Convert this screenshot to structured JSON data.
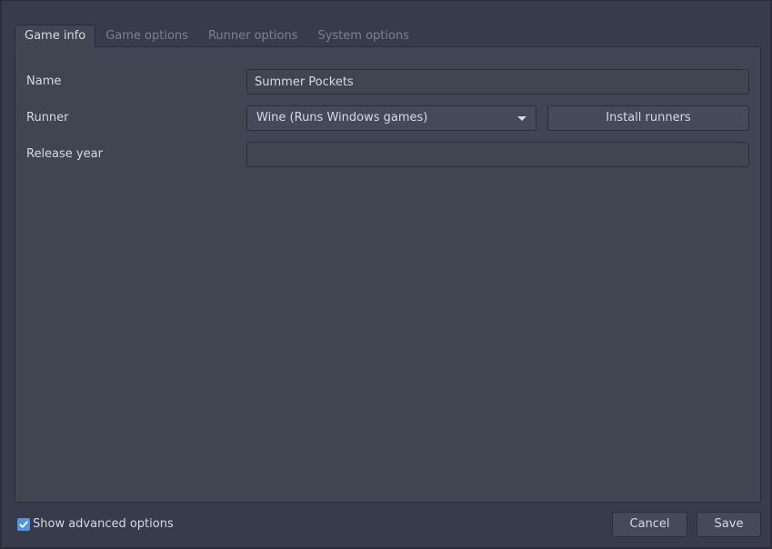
{
  "tabs": [
    {
      "label": "Game info",
      "active": true
    },
    {
      "label": "Game options",
      "active": false
    },
    {
      "label": "Runner options",
      "active": false
    },
    {
      "label": "System options",
      "active": false
    }
  ],
  "form": {
    "name_label": "Name",
    "name_value": "Summer Pockets",
    "runner_label": "Runner",
    "runner_selected": "Wine (Runs Windows games)",
    "install_runners_label": "Install runners",
    "release_year_label": "Release year",
    "release_year_value": ""
  },
  "footer": {
    "show_advanced_label": "Show advanced options",
    "show_advanced_checked": true,
    "cancel_label": "Cancel",
    "save_label": "Save"
  },
  "colors": {
    "background": "#383c4a",
    "panel": "#404552",
    "accent": "#5294e2",
    "text": "#d3dae3",
    "inactive_text": "#7c818c"
  },
  "icons": {
    "dropdown": "chevron-down-icon",
    "check": "check-icon"
  }
}
